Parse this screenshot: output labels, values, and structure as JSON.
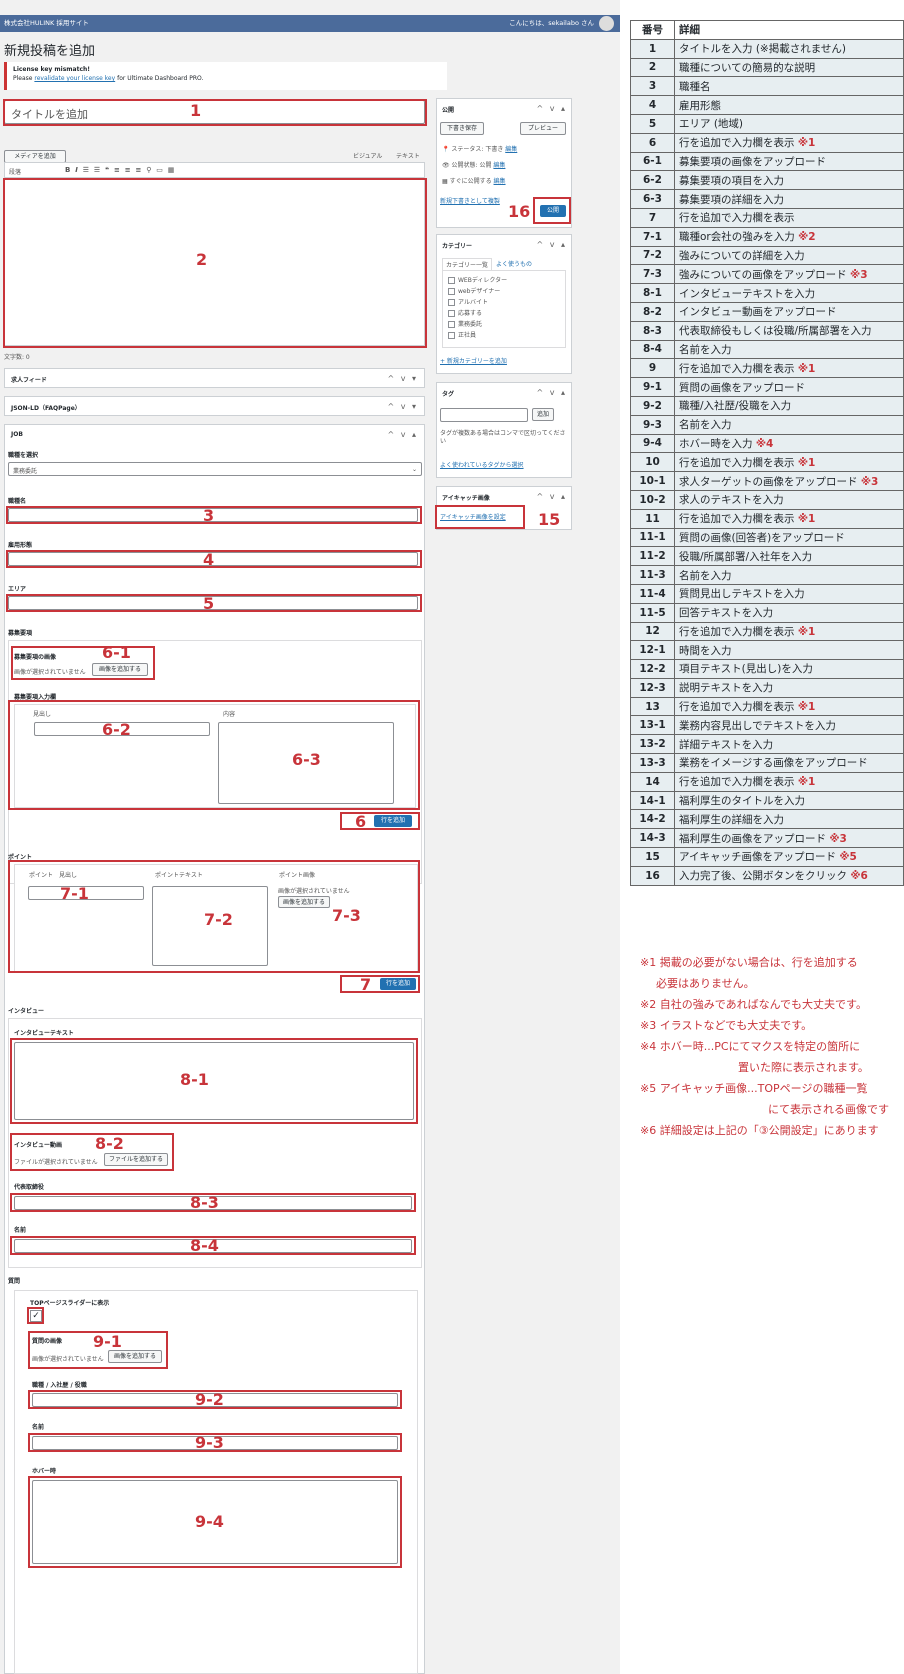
{
  "adminbar": {
    "site": "株式会社HULINK 採用サイト",
    "greeting": "こんにちは、sekailabo さん"
  },
  "page_title": "新規投稿を追加",
  "notice": {
    "line1": "License key mismatch!",
    "line2_pre": "Please ",
    "line2_link": "revalidate your license key",
    "line2_post": " for Ultimate Dashboard PRO."
  },
  "editor": {
    "title_placeholder": "タイトルを追加",
    "media_btn": "メディアを追加",
    "tab_visual": "ビジュアル",
    "tab_text": "テキスト",
    "format": "段落",
    "wordcount": "文字数: 0"
  },
  "publish": {
    "title": "公開",
    "save_draft": "下書き保存",
    "preview": "プレビュー",
    "status": "ステータス: 下書き",
    "status_edit": "編集",
    "visibility": "公開状態: 公開",
    "visibility_edit": "編集",
    "schedule": "すぐに公開する",
    "schedule_edit": "編集",
    "copy": "新規下書きとして複製",
    "publish_btn": "公開"
  },
  "category": {
    "title": "カテゴリー",
    "tab_all": "カテゴリー一覧",
    "tab_pop": "よく使うもの",
    "items": [
      "WEBディレクター",
      "webデザイナー",
      "アルバイト",
      "応募する",
      "業務委託",
      "正社員"
    ],
    "add": "+ 新規カテゴリーを追加"
  },
  "tags": {
    "title": "タグ",
    "add": "追加",
    "hint": "タグが複数ある場合はコンマで区切ってください",
    "choose": "よく使われているタグから選択"
  },
  "eyecatch": {
    "title": "アイキャッチ画像",
    "set": "アイキャッチ画像を設定"
  },
  "panels": {
    "feed": "求人フィード",
    "jsonld": "JSON-LD（FAQPage）",
    "job": "JOB"
  },
  "job": {
    "type_label": "職種を選択",
    "type_value": "業務委託",
    "name_label": "職種名",
    "emp_label": "雇用形態",
    "area_label": "エリア",
    "recruit_label": "募集要項",
    "recruit_img_label": "募集要項の画像",
    "no_image": "画像が選択されていません",
    "add_image": "画像を追加する",
    "recruit_input": "募集要項入力欄",
    "col_heading": "見出し",
    "col_content": "内容",
    "add_row": "行を追加"
  },
  "point": {
    "label": "ポイント",
    "col1": "ポイント　見出し",
    "col2": "ポイントテキスト",
    "col3": "ポイント画像",
    "no_image": "画像が選択されていません",
    "add_image": "画像を追加する",
    "add_row": "行を追加"
  },
  "interview": {
    "label": "インタビュー",
    "text_label": "インタビューテキスト",
    "video_label": "インタビュー動画",
    "no_file": "ファイルが選択されていません",
    "add_file": "ファイルを追加する",
    "ceo_label": "代表取締役",
    "name_label": "名前"
  },
  "question": {
    "label": "質問",
    "slider": "TOPページスライダーに表示",
    "img_label": "質問の画像",
    "no_image": "画像が選択されていません",
    "add_image": "画像を追加する",
    "role_label": "職種 / 入社歴 / 役職",
    "name_label": "名前",
    "hover_label": "ホバー時"
  },
  "markers": [
    "1",
    "2",
    "16",
    "3",
    "4",
    "5",
    "6-1",
    "6-2",
    "6-3",
    "6",
    "7-1",
    "7-2",
    "7-3",
    "7",
    "8-1",
    "8-2",
    "8-3",
    "8-4",
    "9-1",
    "9-2",
    "9-3",
    "9-4",
    "15"
  ],
  "table": {
    "head_num": "番号",
    "head_detail": "詳細",
    "rows": [
      {
        "n": "1",
        "t": "タイトルを入力 (※掲載されません)",
        "m": ""
      },
      {
        "n": "2",
        "t": "職種についての簡易的な説明",
        "m": ""
      },
      {
        "n": "3",
        "t": "職種名",
        "m": ""
      },
      {
        "n": "4",
        "t": "雇用形態",
        "m": ""
      },
      {
        "n": "5",
        "t": "エリア (地域)",
        "m": ""
      },
      {
        "n": "6",
        "t": "行を追加で入力欄を表示 ",
        "m": "※1"
      },
      {
        "n": "6-1",
        "t": "募集要項の画像をアップロード",
        "m": ""
      },
      {
        "n": "6-2",
        "t": "募集要項の項目を入力",
        "m": ""
      },
      {
        "n": "6-3",
        "t": "募集要項の詳細を入力",
        "m": ""
      },
      {
        "n": "7",
        "t": "行を追加で入力欄を表示",
        "m": ""
      },
      {
        "n": "7-1",
        "t": "職種or会社の強みを入力 ",
        "m": "※2"
      },
      {
        "n": "7-2",
        "t": "強みについての詳細を入力",
        "m": ""
      },
      {
        "n": "7-3",
        "t": "強みについての画像をアップロード ",
        "m": "※3"
      },
      {
        "n": "8-1",
        "t": "インタビューテキストを入力",
        "m": ""
      },
      {
        "n": "8-2",
        "t": "インタビュー動画をアップロード",
        "m": ""
      },
      {
        "n": "8-3",
        "t": "代表取締役もしくは役職/所属部署を入力",
        "m": ""
      },
      {
        "n": "8-4",
        "t": "名前を入力",
        "m": ""
      },
      {
        "n": "9",
        "t": "行を追加で入力欄を表示 ",
        "m": "※1"
      },
      {
        "n": "9-1",
        "t": "質問の画像をアップロード",
        "m": ""
      },
      {
        "n": "9-2",
        "t": "職種/入社歴/役職を入力",
        "m": ""
      },
      {
        "n": "9-3",
        "t": "名前を入力",
        "m": ""
      },
      {
        "n": "9-4",
        "t": "ホバー時を入力 ",
        "m": "※4"
      },
      {
        "n": "10",
        "t": "行を追加で入力欄を表示 ",
        "m": "※1"
      },
      {
        "n": "10-1",
        "t": "求人ターゲットの画像をアップロード ",
        "m": "※3"
      },
      {
        "n": "10-2",
        "t": "求人のテキストを入力",
        "m": ""
      },
      {
        "n": "11",
        "t": "行を追加で入力欄を表示 ",
        "m": "※1"
      },
      {
        "n": "11-1",
        "t": "質問の画像(回答者)をアップロード",
        "m": ""
      },
      {
        "n": "11-2",
        "t": "役職/所属部署/入社年を入力",
        "m": ""
      },
      {
        "n": "11-3",
        "t": "名前を入力",
        "m": ""
      },
      {
        "n": "11-4",
        "t": "質問見出しテキストを入力",
        "m": ""
      },
      {
        "n": "11-5",
        "t": "回答テキストを入力",
        "m": ""
      },
      {
        "n": "12",
        "t": "行を追加で入力欄を表示 ",
        "m": "※1"
      },
      {
        "n": "12-1",
        "t": "時間を入力",
        "m": ""
      },
      {
        "n": "12-2",
        "t": "項目テキスト(見出し)を入力",
        "m": ""
      },
      {
        "n": "12-3",
        "t": "説明テキストを入力",
        "m": ""
      },
      {
        "n": "13",
        "t": "行を追加で入力欄を表示 ",
        "m": "※1"
      },
      {
        "n": "13-1",
        "t": "業務内容見出しでテキストを入力",
        "m": ""
      },
      {
        "n": "13-2",
        "t": "詳細テキストを入力",
        "m": ""
      },
      {
        "n": "13-3",
        "t": "業務をイメージする画像をアップロード",
        "m": ""
      },
      {
        "n": "14",
        "t": "行を追加で入力欄を表示 ",
        "m": "※1"
      },
      {
        "n": "14-1",
        "t": "福利厚生のタイトルを入力",
        "m": ""
      },
      {
        "n": "14-2",
        "t": "福利厚生の詳細を入力",
        "m": ""
      },
      {
        "n": "14-3",
        "t": "福利厚生の画像をアップロード ",
        "m": "※3"
      },
      {
        "n": "15",
        "t": "アイキャッチ画像をアップロード ",
        "m": "※5"
      },
      {
        "n": "16",
        "t": "入力完了後、公開ボタンをクリック ",
        "m": "※6"
      }
    ]
  },
  "notes": {
    "n1a": "※1 掲載の必要がない場合は、行を追加する",
    "n1b": "必要はありません。",
    "n2": "※2 自社の強みであればなんでも大丈夫です。",
    "n3": "※3 イラストなどでも大丈夫です。",
    "n4a": "※4 ホバー時...PCにてマクスを特定の箇所に",
    "n4b": "置いた際に表示されます。",
    "n5a": "※5 アイキャッチ画像...TOPページの職種一覧",
    "n5b": "にて表示される画像です",
    "n6": "※6 詳細設定は上記の「③公開設定」にあります"
  }
}
